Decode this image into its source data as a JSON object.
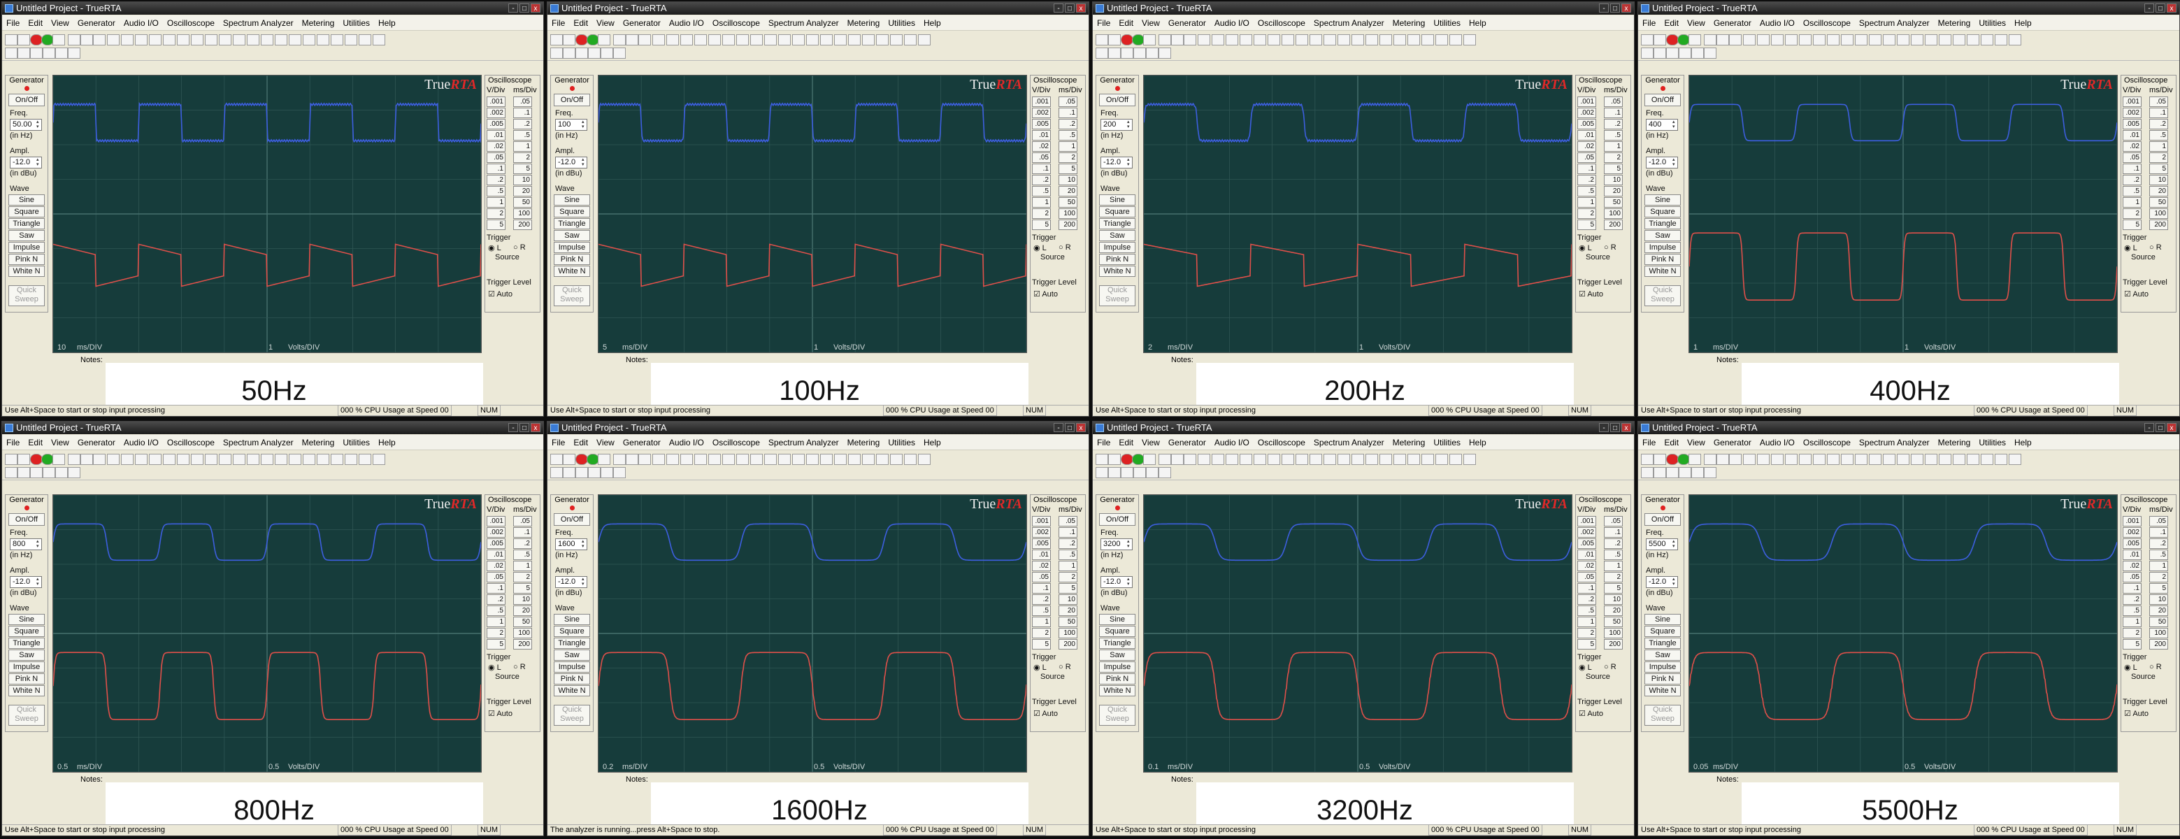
{
  "window": {
    "title": "Untitled Project - TrueRTA",
    "title_buttons": [
      "-",
      "□",
      "x"
    ],
    "menu": [
      "File",
      "Edit",
      "View",
      "Generator",
      "Audio I/O",
      "Oscilloscope",
      "Spectrum Analyzer",
      "Metering",
      "Utilities",
      "Help"
    ]
  },
  "generator": {
    "title": "Generator",
    "on_off": "On/Off",
    "freq_label": "Freq.",
    "freq_unit": "(in Hz)",
    "ampl_label": "Ampl.",
    "ampl_value": "-12.0",
    "ampl_unit": "(in dBu)",
    "wave_label": "Wave",
    "waves": [
      "Sine",
      "Square",
      "Triangle",
      "Saw",
      "Impulse",
      "Pink N",
      "White N"
    ],
    "quick_sweep": "Quick Sweep"
  },
  "oscilloscope": {
    "title": "Oscilloscope",
    "vdiv_label": "V/Div",
    "msdiv_label": "ms/Div",
    "vdiv_values": [
      ".001",
      ".002",
      ".005",
      ".01",
      ".02",
      ".05",
      ".1",
      ".2",
      ".5",
      "1",
      "2",
      "5"
    ],
    "msdiv_values": [
      ".05",
      ".1",
      ".2",
      ".5",
      "1",
      "2",
      "5",
      "10",
      "20",
      "50",
      "100",
      "200"
    ],
    "trigger_label": "Trigger",
    "trigger_l": "L",
    "trigger_r": "R",
    "source_label": "Source",
    "trigger_level": "Trigger Level",
    "auto": "Auto"
  },
  "screen": {
    "brand_true": "True",
    "brand_rta": "RTA",
    "volts_value": "1",
    "volts_unit": "Volts/DIV",
    "ms_unit": "ms/DIV"
  },
  "notes_label": "Notes:",
  "status": {
    "cpu": "000 % CPU Usage at Speed 00",
    "num": "NUM"
  },
  "panels": [
    {
      "freq_label": "50Hz",
      "freq_field": "50.00",
      "ms_per_div": "10",
      "status_text": "Use Alt+Space to start or stop input processing",
      "periods": 5
    },
    {
      "freq_label": "100Hz",
      "freq_field": "100",
      "ms_per_div": "5",
      "status_text": "Use Alt+Space to start or stop input processing",
      "periods": 5
    },
    {
      "freq_label": "200Hz",
      "freq_field": "200",
      "ms_per_div": "2",
      "status_text": "Use Alt+Space to start or stop input processing",
      "periods": 4
    },
    {
      "freq_label": "400Hz",
      "freq_field": "400",
      "ms_per_div": "1",
      "status_text": "Use Alt+Space to start or stop input processing",
      "periods": 4
    },
    {
      "freq_label": "800Hz",
      "freq_field": "800",
      "ms_per_div": "0.5",
      "volts_override": "0.5",
      "status_text": "Use Alt+Space to start or stop input processing",
      "periods": 4
    },
    {
      "freq_label": "1600Hz",
      "freq_field": "1600",
      "ms_per_div": "0.2",
      "volts_override": "0.5",
      "status_text": "The analyzer is running...press Alt+Space to stop.",
      "periods": 3
    },
    {
      "freq_label": "3200Hz",
      "freq_field": "3200",
      "ms_per_div": "0.1",
      "volts_override": "0.5",
      "status_text": "Use Alt+Space to start or stop input processing",
      "periods": 3
    },
    {
      "freq_label": "5500Hz",
      "freq_field": "5500",
      "ms_per_div": "0.05",
      "volts_override": "0.5",
      "status_text": "Use Alt+Space to start or stop input processing",
      "periods": 3
    }
  ],
  "colors": {
    "trace_top": "#3d5fe0",
    "trace_bottom": "#e0504a",
    "screen_bg": "#163c3b",
    "grid": "#2f5654"
  }
}
